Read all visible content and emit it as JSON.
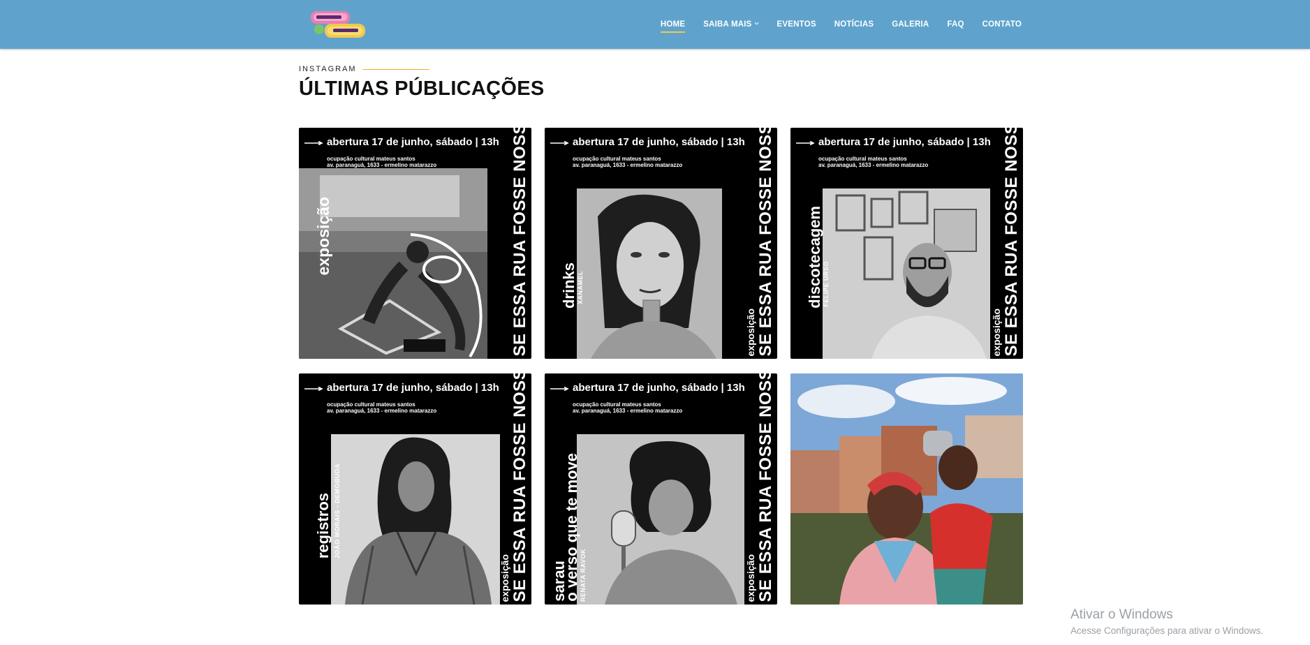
{
  "header": {
    "logo_alt": "Amigos do Bairro",
    "nav": [
      {
        "label": "HOME",
        "active": true
      },
      {
        "label": "SAIBA MAIS",
        "has_dropdown": true
      },
      {
        "label": "EVENTOS"
      },
      {
        "label": "NOTÍCIAS"
      },
      {
        "label": "GALERIA"
      },
      {
        "label": "FAQ"
      },
      {
        "label": "CONTATO"
      }
    ]
  },
  "section": {
    "eyebrow": "INSTAGRAM",
    "title": "ÚLTIMAS PÚBLICAÇÕES"
  },
  "posts": [
    {
      "headline": "abertura 17 de junho, sábado | 13h",
      "line1": "ocupação cultural mateus santos",
      "line2": "av. paranaguá, 1633 - ermelino matarazzo",
      "side_title": "exposição",
      "side_credit": "",
      "vertical": "SE ESSA RUA FOSSE NOSSA",
      "vertical_small": ""
    },
    {
      "headline": "abertura 17 de junho, sábado | 13h",
      "line1": "ocupação cultural mateus santos",
      "line2": "av. paranaguá, 1633 - ermelino matarazzo",
      "side_title": "drinks",
      "side_credit": "XANAMEL",
      "vertical": "SE ESSA RUA FOSSE NOSSA",
      "vertical_small": "exposição"
    },
    {
      "headline": "abertura 17 de junho, sábado | 13h",
      "line1": "ocupação cultural mateus santos",
      "line2": "av. paranaguá, 1633 - ermelino matarazzo",
      "side_title": "discotecagem",
      "side_credit": "FELIPE URSO",
      "vertical": "SE ESSA RUA FOSSE NOSSA",
      "vertical_small": "exposição"
    },
    {
      "headline": "abertura 17 de junho, sábado | 13h",
      "line1": "ocupação cultural mateus santos",
      "line2": "av. paranaguá, 1633 - ermelino matarazzo",
      "side_title": "registros",
      "side_credit": "JOÃO MORAIS - DEMOBUDA",
      "vertical": "SE ESSA RUA FOSSE NOSSA",
      "vertical_small": "exposição"
    },
    {
      "headline": "abertura 17 de junho, sábado | 13h",
      "line1": "ocupação cultural mateus santos",
      "line2": "av. paranaguá, 1633 - ermelino matarazzo",
      "side_title": "sarau",
      "side_title2": "o verso que te move",
      "side_credit": "RENATA RAVOK",
      "vertical": "SE ESSA RUA FOSSE NOSSA",
      "vertical_small": "exposição"
    }
  ],
  "watermark": {
    "line1": "Ativar o Windows",
    "line2": "Acesse Configurações para ativar o Windows."
  }
}
